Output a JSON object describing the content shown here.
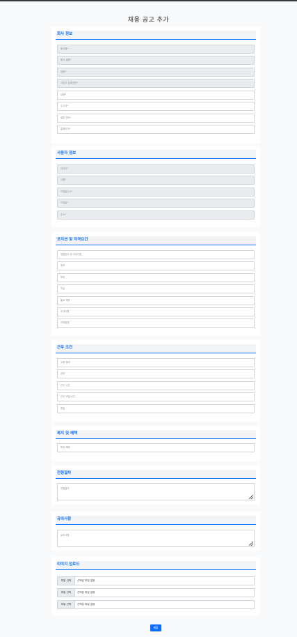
{
  "page": {
    "title": "채용 공고 추가"
  },
  "sections": {
    "company": {
      "title": "회사 정보",
      "fields": [
        "회사명*",
        "회사 설명*",
        "업종*",
        "사업자 등록번호*",
        "대표*",
        "주소지*",
        "설립 연도*",
        "홈페이지*"
      ]
    },
    "user": {
      "title": "사용자 정보",
      "fields": [
        "아이디*",
        "이름*",
        "이메일주소*",
        "이메일*",
        "주소*"
      ]
    },
    "position": {
      "title": "포지션 및 자격요건",
      "fields": [
        "채용분야 및 모집인원",
        "경력",
        "학력",
        "직급",
        "필요 역량",
        "우대사항",
        "자격증명"
      ]
    },
    "work": {
      "title": "근무 조건",
      "fields": [
        "고용 형태",
        "급여",
        "근무 시간",
        "근무 요일/시간",
        "휴일"
      ]
    },
    "benefits": {
      "title": "복지 및 혜택",
      "fields": [
        "복지 혜택"
      ]
    },
    "process": {
      "title": "전형절차",
      "placeholder": "전형절차"
    },
    "notice": {
      "title": "유의사항",
      "placeholder": "유의사항"
    },
    "images": {
      "title": "이미지 업로드",
      "button_label": "파일 선택",
      "status_text": "선택된 파일 없음",
      "count": 3
    }
  },
  "submit_label": "제출"
}
